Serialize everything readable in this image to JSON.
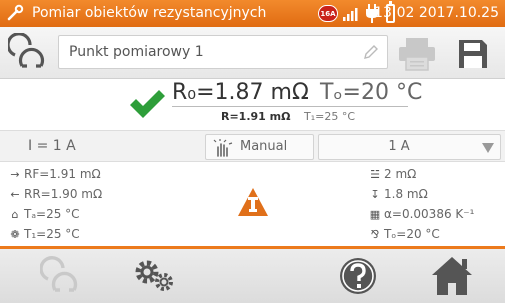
{
  "status_bar": {
    "title": "Pomiar obiektów rezystancyjnych",
    "badge": "16A",
    "time": "13:02 2017.10.25"
  },
  "toolbar": {
    "point_name": "Punkt pomiarowy 1"
  },
  "reading": {
    "r0": "R₀=1.87 mΩ",
    "t0": "Tₒ=20 °C",
    "r": "R=1.91 mΩ",
    "t1": "T₁=25 °C"
  },
  "settings": {
    "current": "I = 1 A",
    "mode": "Manual",
    "range": "1 A"
  },
  "details": {
    "rf": "RF=1.91 mΩ",
    "rr": "RR=1.90 mΩ",
    "ta": "Tₐ=25 °C",
    "t1": "T₁=25 °C",
    "res1": "2 mΩ",
    "res2": "1.8 mΩ",
    "alpha": "α=0.00386 K⁻¹",
    "t0": "Tₒ=20 °C"
  },
  "colors": {
    "accent": "#ec7a1c",
    "ok": "#2e9e3a",
    "warning": "#e0701a"
  }
}
